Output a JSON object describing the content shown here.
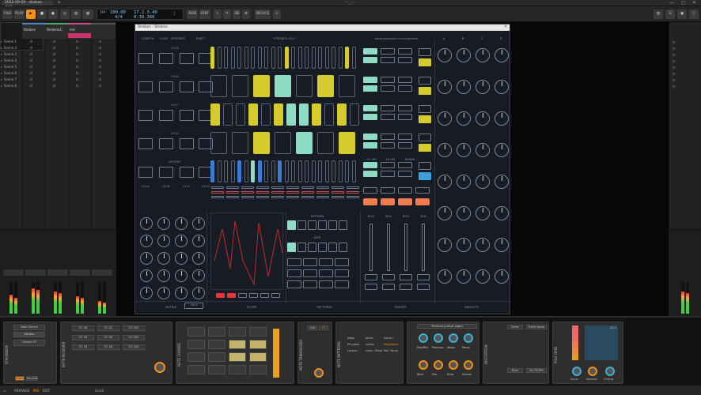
{
  "window": {
    "tab_title": "2022-09-29 - strokes dem...",
    "controls": [
      "—",
      "▢",
      "✕"
    ]
  },
  "toolbar": {
    "file": "FILE",
    "play": "PLAY",
    "tempo": "100.00",
    "tempo_label": "TAP",
    "signature": "4/4",
    "position": "17.2.3.40",
    "time": "0:39.360",
    "add_label": "ADD",
    "edit_label": "EDIT",
    "device_label": "DEVICE"
  },
  "tracks": {
    "names": [
      "Strokes",
      "StrokesLC",
      "mic",
      ""
    ],
    "scenes": [
      "Scene 1",
      "Scene 2",
      "Scene 3",
      "Scene 4",
      "Scene 5",
      "Scene 6",
      "Scene 7",
      "Scene 8"
    ]
  },
  "plugin": {
    "title": "Strokes - Strokes",
    "header_labels": [
      "LENGTH",
      "LOOP",
      "STROKES",
      "SHIFT"
    ],
    "plugin_name": "STROKES v3.0",
    "url": "www.sonigkurn.co.uk/strokes",
    "channels": [
      "CH A",
      "CH B",
      "CH C",
      "CH D"
    ],
    "accent": "ACCENT",
    "col_letters": [
      "A",
      "B",
      "C",
      "D"
    ],
    "bottom_sections": [
      "MATRIX",
      "SCOPE",
      "PATTERNS",
      "SHAPES",
      "WEIGHTS"
    ],
    "pattern_label": "PATTERN",
    "hits_label": "HITS",
    "vel_labels": [
      "LO VEL",
      "HI VEL",
      "SWING"
    ],
    "shape_percents": [
      "61%",
      "38%",
      "60%",
      "39%"
    ],
    "row_channels": [
      "CH A",
      "CH B",
      "CH C",
      "CH D"
    ]
  },
  "devices": {
    "note_source_title": "Note Source",
    "note_source_item": "Strokes",
    "source_button": "Source FX",
    "section_labels": [
      "STROKEBOX",
      "NOTE RECEIVER",
      "OUTPUT",
      "NOTE CHORDS",
      "NOTE TRANSPOSER",
      "NOTE PATTERNS",
      "DISTORTION",
      "TRANSIENT",
      "POLY GRID"
    ],
    "cc_labels": [
      "CC 28",
      "CC 22",
      "CC 103",
      "CC 24",
      "CC 20",
      "CC 102",
      "CC 19",
      "CC 18",
      "CC 104"
    ],
    "oct_label": "Oct",
    "oct_value": "+1",
    "scale_notes": [
      "Major",
      "Minor",
      "Dorian",
      "Phrygian",
      "Lydian",
      "Mixolydian",
      "Locrian",
      "Harm. Minor",
      "Mel. Minor"
    ],
    "perfume_title": "Perfume (preset page)",
    "perfume_knobs": [
      "Pale/Mixr",
      "Pale/max",
      "Attack",
      "Decay"
    ],
    "perfume_knobs2": [
      "Bend",
      "Fine",
      "Drive",
      "Volume"
    ],
    "drive_labels": [
      "Drive",
      "Drive comp"
    ],
    "filter_labels": [
      "Filter",
      "DC FILTER"
    ],
    "grid_labels": [
      "Input",
      "Release",
      "Ceiling"
    ],
    "grid_value": "-24.1"
  },
  "status": {
    "arrange": "ARRANGE",
    "mix": "MIX",
    "edit": "EDIT",
    "hint": "Scroll"
  },
  "colors": {
    "accent_orange": "#f29116",
    "yellow": "#d6cb2c",
    "mint": "#8fdcc5",
    "blue": "#3b7bd4",
    "coral": "#f07b4c"
  }
}
